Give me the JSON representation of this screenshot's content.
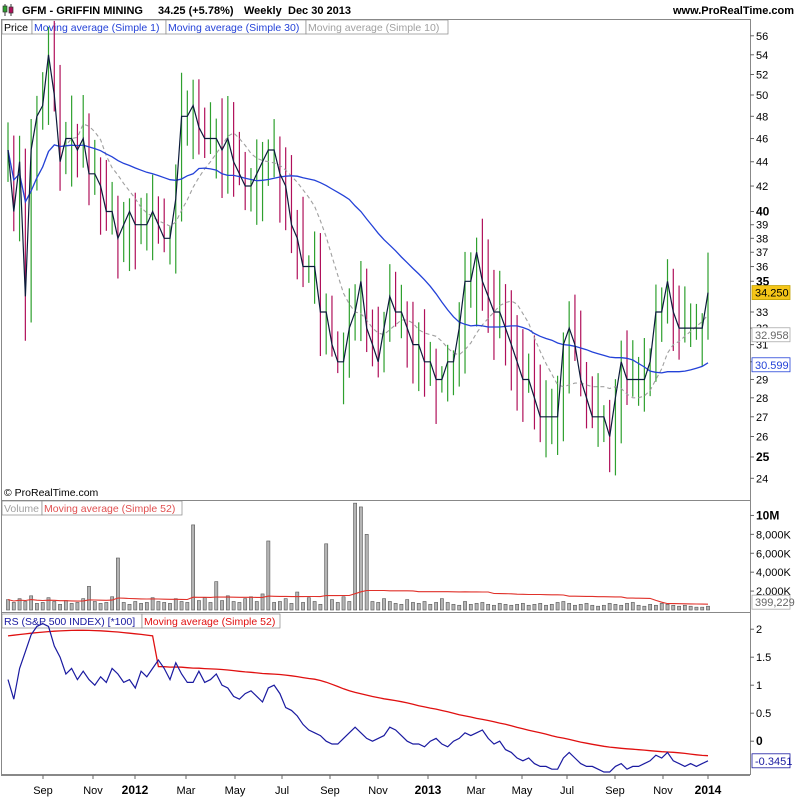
{
  "header": {
    "title": "GFM - GRIFFIN MINING",
    "quote": "34.25 (+5.78%)",
    "period": "Weekly",
    "date": "Dec 30 2013",
    "site": "www.ProRealTime.com"
  },
  "copyright": "© ProRealTime.com",
  "colors": {
    "up": "#2ea02e",
    "down": "#b0105a",
    "close_line": "#0b1a3a",
    "ma30": "#2442d8",
    "ma10": "#a0a0a0",
    "vol_bar": "#b4b4b4",
    "vol_ma": "#e0312a",
    "rs_line": "#1a1aa0",
    "rs_ma": "#e01010"
  },
  "chart_data": [
    {
      "type": "ohlc",
      "panel": "price",
      "legend": [
        "Price",
        "Moving average (Simple 1)",
        "Moving average (Simple 30)",
        "Moving average (Simple 10)"
      ],
      "y_ticks": [
        "56",
        "54",
        "52",
        "50",
        "48",
        "46",
        "44",
        "42",
        "40",
        "39",
        "38",
        "37",
        "36",
        "35",
        "33",
        "32",
        "31",
        "30",
        "29",
        "28",
        "27",
        "26",
        "25",
        "24"
      ],
      "y_bold_ticks": [
        "40",
        "35",
        "30",
        "25"
      ],
      "y_log": true,
      "ylim": [
        23.2,
        57.5
      ],
      "x_labels": [
        "Sep",
        "Nov",
        "2012",
        "Mar",
        "May",
        "Jul",
        "Sep",
        "Nov",
        "2013",
        "Mar",
        "May",
        "Jul",
        "Sep",
        "Nov",
        "2014"
      ],
      "x_bold_labels": [
        "2012",
        "2013",
        "2014"
      ],
      "close": [
        45,
        40,
        44,
        34,
        45,
        48,
        49,
        54,
        50,
        44,
        46,
        46,
        45,
        46,
        43,
        43,
        42,
        40,
        40,
        38,
        39,
        40,
        39,
        39,
        39,
        40,
        39,
        38,
        38,
        41,
        48,
        48,
        49,
        47,
        46,
        46,
        46,
        45,
        46,
        44,
        43,
        42,
        42,
        43,
        44,
        45,
        45,
        43,
        42,
        39,
        38,
        36,
        36,
        36,
        33,
        33,
        31,
        30,
        30,
        32,
        33,
        35,
        32,
        31,
        30,
        32,
        34,
        33,
        33,
        32,
        31,
        31,
        30,
        30,
        29,
        29,
        30,
        30,
        32,
        35,
        35,
        37,
        35,
        34,
        33,
        33,
        32,
        31,
        30,
        29,
        29,
        28,
        27,
        27,
        27,
        27,
        31,
        32,
        31,
        29,
        28,
        27,
        27,
        27,
        26,
        28,
        30,
        29,
        29,
        29,
        29,
        30,
        33,
        33,
        35,
        33,
        32,
        32,
        32,
        32,
        32,
        34.25
      ],
      "current_close_label": "34.250",
      "ma10_label": "32.958",
      "ma30_label": "30.599"
    },
    {
      "type": "bar",
      "panel": "volume",
      "legend": [
        "Volume",
        "Moving average (Simple 52)"
      ],
      "y_ticks": [
        "10M",
        "8,000K",
        "6,000K",
        "4,000K",
        "2,000K"
      ],
      "ylim": [
        0,
        11000000
      ],
      "values": [
        1100000,
        800000,
        1200000,
        900000,
        1500000,
        700000,
        800000,
        1300000,
        900000,
        600000,
        1000000,
        700000,
        800000,
        1200000,
        2500000,
        900000,
        700000,
        800000,
        1400000,
        5500000,
        800000,
        600000,
        900000,
        700000,
        800000,
        1300000,
        900000,
        800000,
        700000,
        1200000,
        900000,
        800000,
        9000000,
        1000000,
        1300000,
        800000,
        3000000,
        1000000,
        1500000,
        900000,
        800000,
        1200000,
        1400000,
        900000,
        1700000,
        7300000,
        800000,
        900000,
        1200000,
        700000,
        1900000,
        800000,
        1300000,
        900000,
        600000,
        7000000,
        1100000,
        800000,
        1400000,
        900000,
        11300000,
        10900000,
        8000000,
        900000,
        800000,
        1200000,
        900000,
        700000,
        600000,
        1100000,
        800000,
        700000,
        900000,
        600000,
        800000,
        1200000,
        800000,
        600000,
        500000,
        900000,
        600000,
        700000,
        800000,
        600000,
        500000,
        700000,
        600000,
        500000,
        600000,
        700000,
        500000,
        600000,
        700000,
        500000,
        600000,
        800000,
        900000,
        700000,
        500000,
        600000,
        700000,
        500000,
        400000,
        500000,
        700000,
        600000,
        500000,
        700000,
        800000,
        500000,
        400000,
        600000,
        500000,
        700000,
        600000,
        500000,
        400000,
        500000,
        400000,
        300000,
        300000,
        400000
      ],
      "ma_label": "399,229"
    },
    {
      "type": "line",
      "panel": "rs",
      "legend": [
        "RS (S&P 500 INDEX) [*100]",
        "Moving average (Simple 52)"
      ],
      "y_ticks": [
        "2",
        "1.5",
        "1",
        "0.5",
        "0"
      ],
      "ylim": [
        -0.55,
        2.2
      ],
      "values": [
        1.1,
        0.75,
        1.3,
        1.6,
        1.9,
        2.05,
        2.1,
        2.05,
        1.7,
        1.5,
        1.2,
        1.3,
        1.1,
        1.25,
        1.1,
        1.0,
        1.15,
        1.05,
        1.3,
        1.2,
        1.05,
        1.1,
        0.95,
        1.25,
        1.15,
        1.3,
        1.45,
        1.3,
        1.1,
        1.4,
        1.2,
        1.05,
        1.05,
        1.25,
        1.05,
        1.1,
        1.2,
        1.0,
        0.95,
        0.8,
        0.75,
        0.85,
        0.9,
        0.8,
        0.7,
        0.95,
        1.0,
        0.85,
        0.6,
        0.55,
        0.45,
        0.3,
        0.2,
        0.15,
        0.1,
        0.0,
        -0.05,
        -0.05,
        0.05,
        0.15,
        0.25,
        0.15,
        0.05,
        0.0,
        0.05,
        0.1,
        0.25,
        0.2,
        0.1,
        0.0,
        -0.05,
        -0.05,
        -0.1,
        0.0,
        0.05,
        -0.05,
        -0.1,
        0.0,
        0.05,
        0.15,
        0.1,
        0.15,
        0.2,
        0.05,
        -0.05,
        0.0,
        -0.15,
        -0.2,
        -0.3,
        -0.35,
        -0.3,
        -0.4,
        -0.45,
        -0.45,
        -0.5,
        -0.5,
        -0.3,
        -0.2,
        -0.3,
        -0.4,
        -0.45,
        -0.45,
        -0.5,
        -0.55,
        -0.55,
        -0.45,
        -0.4,
        -0.5,
        -0.45,
        -0.45,
        -0.4,
        -0.35,
        -0.25,
        -0.3,
        -0.2,
        -0.35,
        -0.4,
        -0.45,
        -0.4,
        -0.45,
        -0.4,
        -0.35
      ],
      "ma_label": "-0.3451"
    }
  ]
}
